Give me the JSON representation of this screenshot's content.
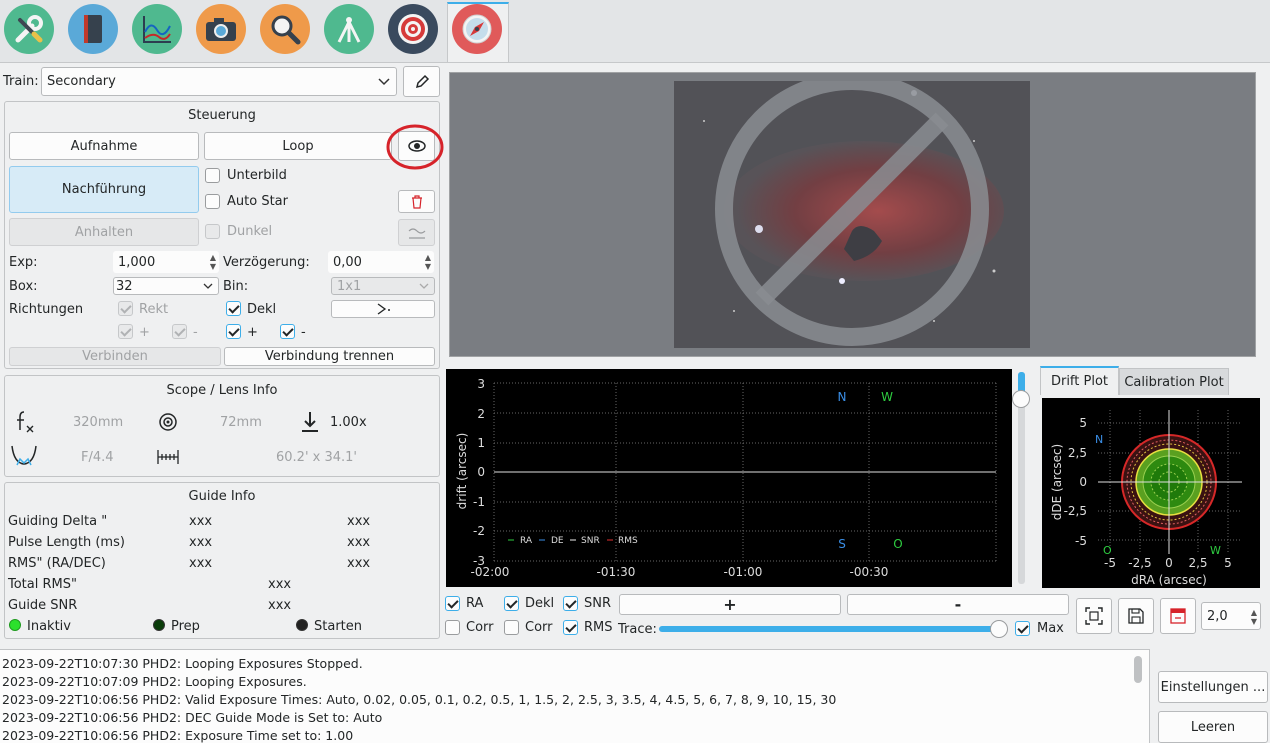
{
  "tabs": [
    {
      "icon": "wrench-screwdriver-icon",
      "bg": "#4fb98f"
    },
    {
      "icon": "notebook-icon",
      "bg": "#5aa9d8"
    },
    {
      "icon": "chart-icon",
      "bg": "#4fb98f"
    },
    {
      "icon": "camera-icon",
      "bg": "#ef9a4a"
    },
    {
      "icon": "magnifier-icon",
      "bg": "#ef9a4a"
    },
    {
      "icon": "telescope-mount-icon",
      "bg": "#4fb98f"
    },
    {
      "icon": "target-icon",
      "bg": "#3a4a5e"
    },
    {
      "icon": "guide-compass-icon",
      "bg": "#e05a5a"
    }
  ],
  "train": {
    "label": "Train:",
    "value": "Secondary"
  },
  "control": {
    "title": "Steuerung",
    "capture": "Aufnahme",
    "loop": "Loop",
    "guide": "Nachführung",
    "stop": "Anhalten",
    "subframe": "Unterbild",
    "autostar": "Auto Star",
    "dark": "Dunkel",
    "exp_label": "Exp:",
    "exp_value": "1,000",
    "delay_label": "Verzögerung:",
    "delay_value": "0,00",
    "box_label": "Box:",
    "box_value": "32",
    "bin_label": "Bin:",
    "bin_value": "1x1",
    "directions": "Richtungen",
    "ra": "Rekt",
    "dec": "Dekl",
    "plus": "+",
    "minus": "-",
    "connect": "Verbinden",
    "disconnect": "Verbindung trennen"
  },
  "scope": {
    "title": "Scope / Lens Info",
    "focal": "320mm",
    "aperture": "72mm",
    "reducer": "1.00x",
    "fratio": "F/4.4",
    "fov": "60.2' x 34.1'"
  },
  "guideinfo": {
    "title": "Guide Info",
    "rows": [
      {
        "label": "Guiding Delta \"",
        "a": "xxx",
        "b": "xxx"
      },
      {
        "label": "Pulse Length (ms)",
        "a": "xxx",
        "b": "xxx"
      },
      {
        "label": "RMS\" (RA/DEC)",
        "a": "xxx",
        "b": "xxx"
      }
    ],
    "total_label": "Total RMS\"",
    "total_value": "xxx",
    "snr_label": "Guide SNR",
    "snr_value": "xxx",
    "status_inactive": "Inaktiv",
    "status_prep": "Prep",
    "status_start": "Starten"
  },
  "drift_chart": {
    "ylabel": "drift (arcsec)",
    "yticks": [
      "3",
      "2",
      "1",
      "0",
      "-1",
      "-2",
      "-3"
    ],
    "xticks": [
      "-02:00",
      "-01:30",
      "-01:00",
      "-00:30"
    ],
    "compass": {
      "n": "N",
      "w": "W",
      "s": "S",
      "o": "O"
    },
    "legend": [
      "RA",
      "DE",
      "SNR",
      "RMS"
    ]
  },
  "plot_tabs": {
    "drift": "Drift Plot",
    "calibration": "Calibration Plot"
  },
  "scatter": {
    "ylabel": "dDE (arcsec)",
    "xlabel": "dRA (arcsec)",
    "yticks": [
      "5",
      "2,5",
      "0",
      "-2,5",
      "-5"
    ],
    "xticks": [
      "-5",
      "-2,5",
      "0",
      "2,5",
      "5"
    ],
    "n": "N",
    "o": "O",
    "w": "W"
  },
  "chart_controls": {
    "ra": "RA",
    "dekl": "Dekl",
    "snr": "SNR",
    "corr1": "Corr",
    "corr2": "Corr",
    "rms": "RMS",
    "plus": "+",
    "minus": "-",
    "trace": "Trace:",
    "max": "Max",
    "zoom": "2,0"
  },
  "log": [
    "2023-09-22T10:07:30 PHD2: Looping Exposures Stopped.",
    "2023-09-22T10:07:09 PHD2: Looping Exposures.",
    "2023-09-22T10:06:56 PHD2: Valid Exposure Times: Auto, 0.02, 0.05, 0.1, 0.2, 0.5, 1, 1.5, 2, 2.5, 3, 3.5, 4, 4.5, 5, 6, 7, 8, 9, 10, 15, 30",
    "2023-09-22T10:06:56 PHD2: DEC Guide Mode is Set to: Auto",
    "2023-09-22T10:06:56 PHD2: Exposure Time set to: 1.00"
  ],
  "log_buttons": {
    "settings": "Einstellungen ...",
    "clear": "Leeren"
  }
}
